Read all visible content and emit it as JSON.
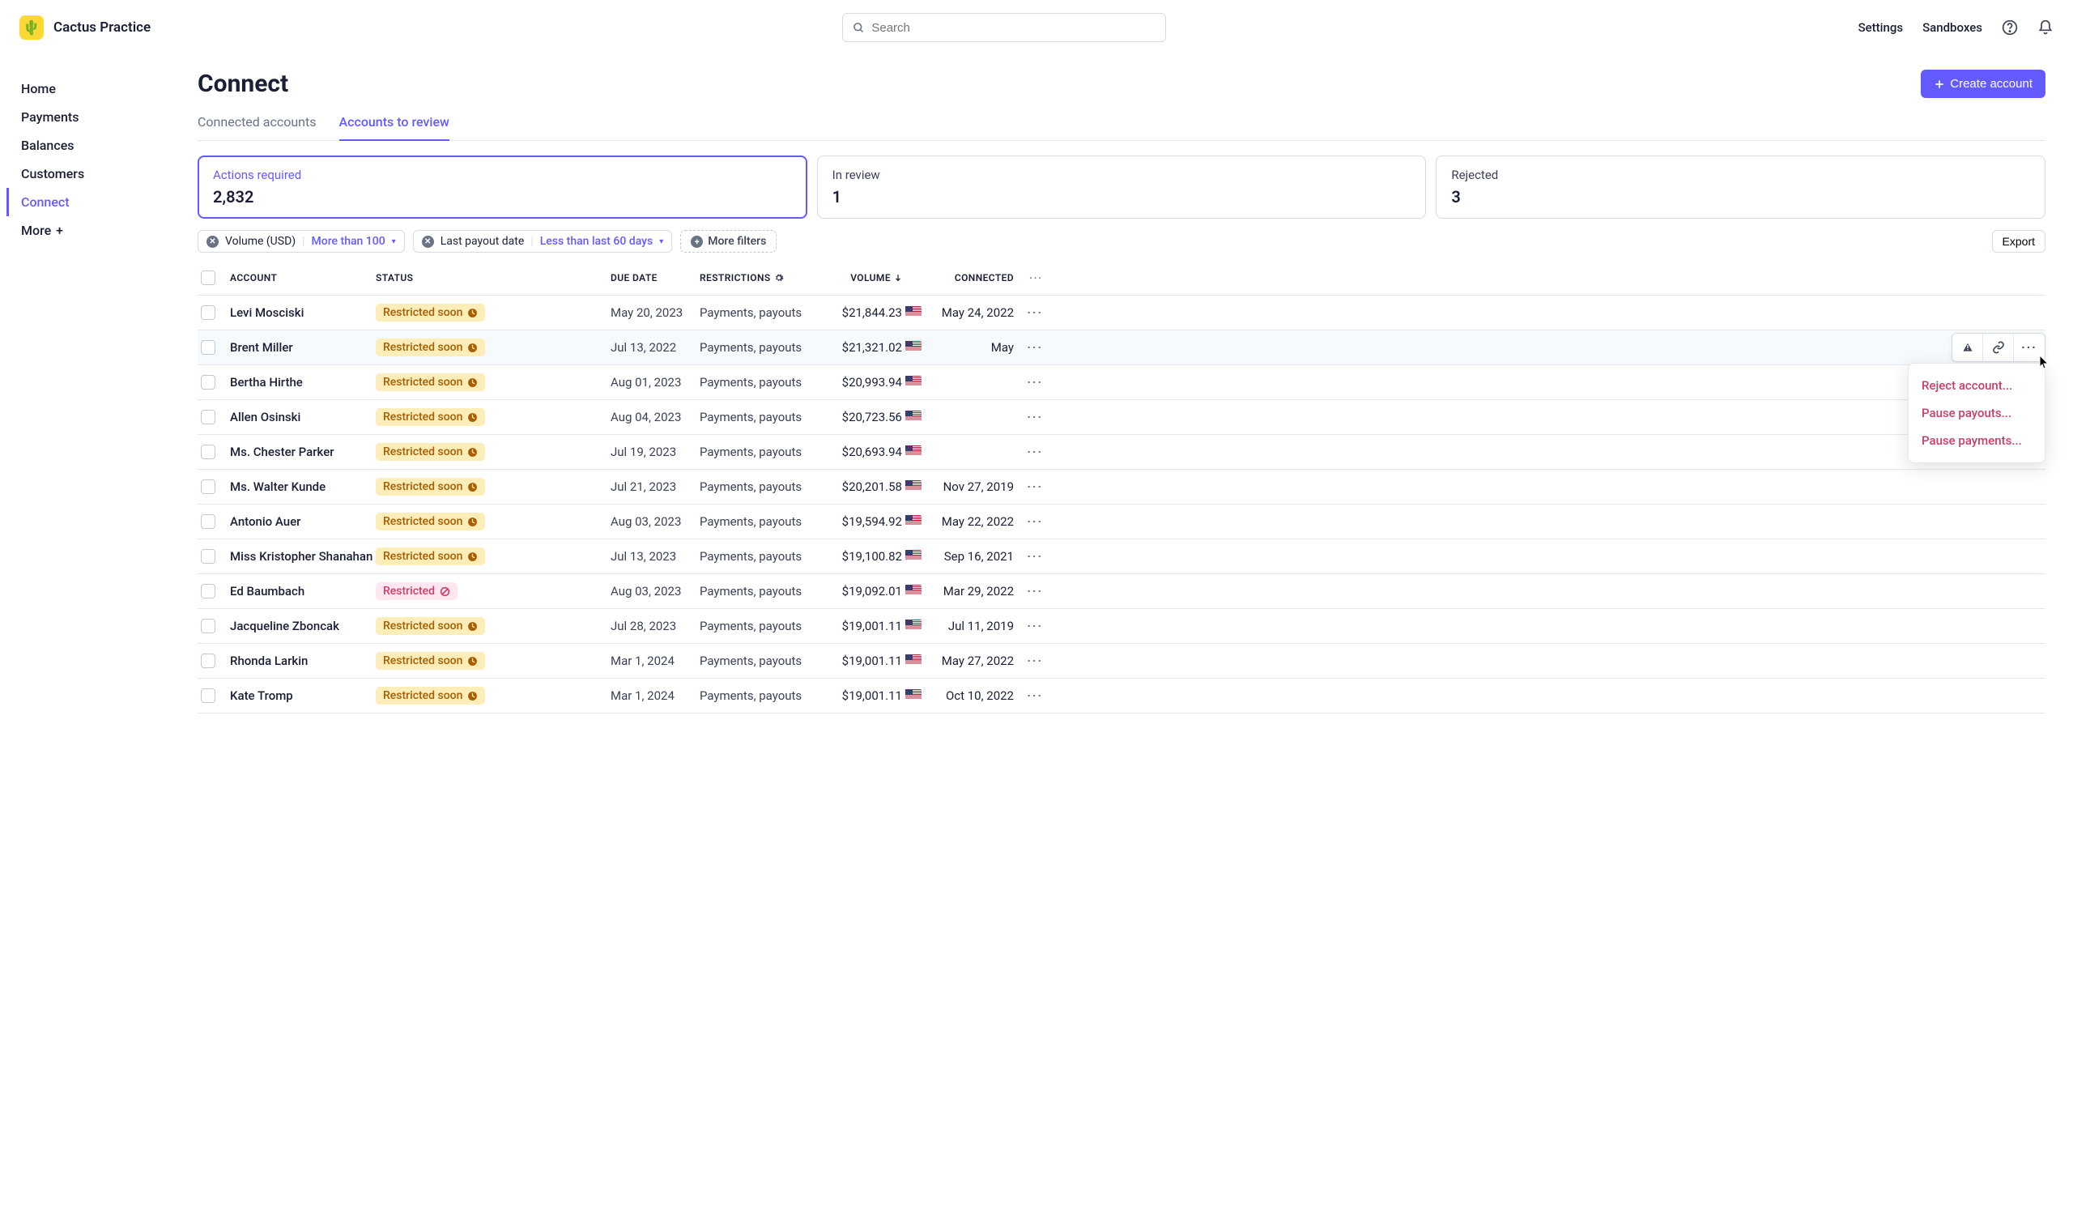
{
  "brand": {
    "name": "Cactus Practice"
  },
  "search": {
    "placeholder": "Search"
  },
  "header_links": {
    "settings": "Settings",
    "sandboxes": "Sandboxes"
  },
  "sidebar": {
    "items": [
      {
        "label": "Home"
      },
      {
        "label": "Payments"
      },
      {
        "label": "Balances"
      },
      {
        "label": "Customers"
      },
      {
        "label": "Connect"
      },
      {
        "label": "More"
      }
    ]
  },
  "page": {
    "title": "Connect",
    "create_label": "Create account",
    "tabs": {
      "connected": "Connected accounts",
      "review": "Accounts to review"
    }
  },
  "stats": {
    "actions": {
      "label": "Actions required",
      "value": "2,832"
    },
    "in_review": {
      "label": "In review",
      "value": "1"
    },
    "rejected": {
      "label": "Rejected",
      "value": "3"
    }
  },
  "filters": {
    "volume": {
      "label": "Volume (USD)",
      "value": "More than 100"
    },
    "payout": {
      "label": "Last payout date",
      "value": "Less than last 60 days"
    },
    "more": "More filters",
    "export": "Export"
  },
  "columns": {
    "account": "ACCOUNT",
    "status": "STATUS",
    "due": "DUE DATE",
    "restrictions": "RESTRICTIONS",
    "volume": "VOLUME",
    "connected": "CONNECTED"
  },
  "status_labels": {
    "soon": "Restricted soon",
    "restricted": "Restricted"
  },
  "rows": [
    {
      "name": "Levi Mosciski",
      "status": "soon",
      "due": "May 20, 2023",
      "restr": "Payments, payouts",
      "vol": "$21,844.23",
      "conn": "May 24, 2022"
    },
    {
      "name": "Brent Miller",
      "status": "soon",
      "due": "Jul 13, 2022",
      "restr": "Payments, payouts",
      "vol": "$21,321.02",
      "conn": "May"
    },
    {
      "name": "Bertha Hirthe",
      "status": "soon",
      "due": "Aug 01, 2023",
      "restr": "Payments, payouts",
      "vol": "$20,993.94",
      "conn": ""
    },
    {
      "name": "Allen Osinski",
      "status": "soon",
      "due": "Aug 04, 2023",
      "restr": "Payments, payouts",
      "vol": "$20,723.56",
      "conn": ""
    },
    {
      "name": "Ms. Chester Parker",
      "status": "soon",
      "due": "Jul 19, 2023",
      "restr": "Payments, payouts",
      "vol": "$20,693.94",
      "conn": ""
    },
    {
      "name": "Ms. Walter Kunde",
      "status": "soon",
      "due": "Jul 21, 2023",
      "restr": "Payments, payouts",
      "vol": "$20,201.58",
      "conn": "Nov 27, 2019"
    },
    {
      "name": "Antonio Auer",
      "status": "soon",
      "due": "Aug 03, 2023",
      "restr": "Payments, payouts",
      "vol": "$19,594.92",
      "conn": "May 22, 2022"
    },
    {
      "name": "Miss Kristopher Shanahan",
      "status": "soon",
      "due": "Jul 13, 2023",
      "restr": "Payments, payouts",
      "vol": "$19,100.82",
      "conn": "Sep 16, 2021"
    },
    {
      "name": "Ed Baumbach",
      "status": "restricted",
      "due": "Aug 03, 2023",
      "restr": "Payments, payouts",
      "vol": "$19,092.01",
      "conn": "Mar 29, 2022"
    },
    {
      "name": "Jacqueline Zboncak",
      "status": "soon",
      "due": "Jul 28, 2023",
      "restr": "Payments, payouts",
      "vol": "$19,001.11",
      "conn": "Jul 11, 2019"
    },
    {
      "name": "Rhonda Larkin",
      "status": "soon",
      "due": "Mar 1, 2024",
      "restr": "Payments, payouts",
      "vol": "$19,001.11",
      "conn": "May 27, 2022"
    },
    {
      "name": "Kate Tromp",
      "status": "soon",
      "due": "Mar 1, 2024",
      "restr": "Payments, payouts",
      "vol": "$19,001.11",
      "conn": "Oct 10, 2022"
    }
  ],
  "dropdown": {
    "reject": "Reject account...",
    "pause_payouts": "Pause payouts...",
    "pause_payments": "Pause payments..."
  }
}
